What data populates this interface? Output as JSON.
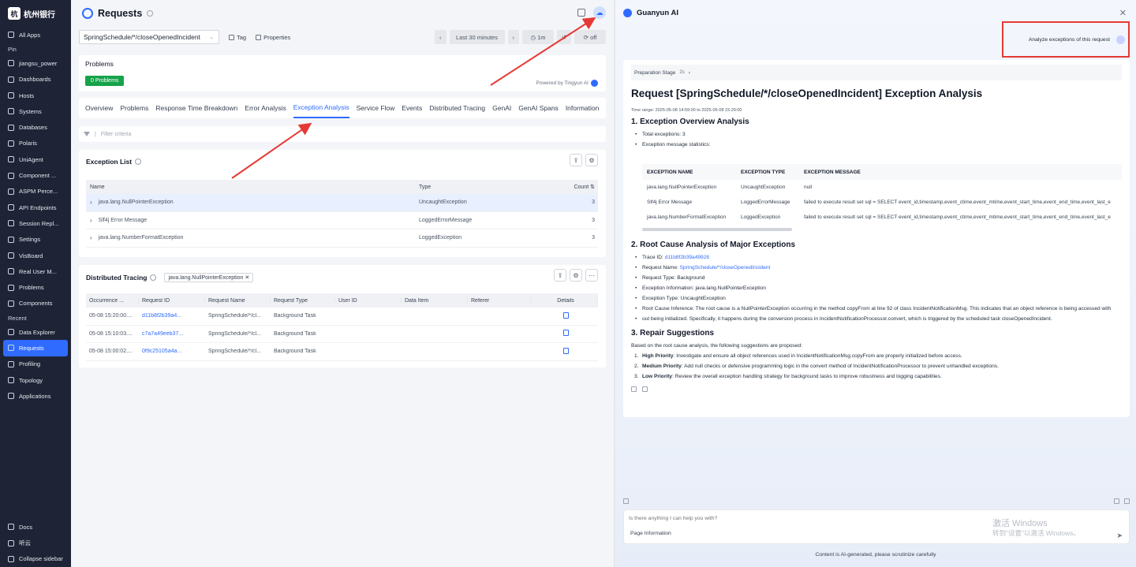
{
  "sidebar": {
    "logo_text": "杭州银行",
    "items_top": [
      "All Apps"
    ],
    "pin_label": "Pin",
    "pinned": [
      "jiangsu_power",
      "Dashboards",
      "Hosts",
      "Systems",
      "Databases",
      "Polaris",
      "UniAgent",
      "Component ...",
      "ASPM Perce...",
      "API Endpoints",
      "Session Repl...",
      "Settings",
      "VisBoard",
      "Real User M...",
      "Problems",
      "Components"
    ],
    "recent_label": "Recent",
    "recent": [
      "Data Explorer",
      "Requests",
      "Profiling",
      "Topology",
      "Applications"
    ],
    "bottom": [
      "Docs",
      "听云",
      "Collapse sidebar"
    ]
  },
  "header": {
    "title": "Requests"
  },
  "filters": {
    "request_select": "SpringSchedule/*/closeOpenedIncident",
    "tag": "Tag",
    "properties": "Properties",
    "time_range": "Last 30 minutes",
    "interval": "1m",
    "refresh": "off"
  },
  "problems": {
    "title": "Problems",
    "badge": "0 Problems",
    "powered": "Powered by Tingyun AI"
  },
  "tabs": [
    "Overview",
    "Problems",
    "Response Time Breakdown",
    "Error Analysis",
    "Exception Analysis",
    "Service Flow",
    "Events",
    "Distributed Tracing",
    "GenAI",
    "GenAI Spans",
    "Information"
  ],
  "criteria_placeholder": "Filter criteria",
  "exception_list": {
    "title": "Exception List",
    "headers": {
      "name": "Name",
      "type": "Type",
      "count": "Count"
    },
    "rows": [
      {
        "name": "java.lang.NullPointerException",
        "type": "UncaughtException",
        "count": "3"
      },
      {
        "name": "Slf4j Error Message",
        "type": "LoggedErrorMessage",
        "count": "3"
      },
      {
        "name": "java.lang.NumberFormatException",
        "type": "LoggedException",
        "count": "3"
      }
    ]
  },
  "distributed": {
    "title": "Distributed Tracing",
    "filter_tag": "java.lang.NullPointerException",
    "headers": [
      "Occurrence ...",
      "Request ID",
      "Request Name",
      "Request Type",
      "User ID",
      "Data Item",
      "Referer",
      "Details"
    ],
    "rows": [
      [
        "05-08 15:20:00....",
        "d11b8f2b39a4...",
        "SpringSchedule/*/cl...",
        "Background Task",
        "",
        "",
        ""
      ],
      [
        "05-08 15:10:03....",
        "c7a7a49eeb37...",
        "SpringSchedule/*/cl...",
        "Background Task",
        "",
        "",
        ""
      ],
      [
        "05-08 15:00:02....",
        "0f9c25105a4a...",
        "SpringSchedule/*/cl...",
        "Background Task",
        "",
        "",
        ""
      ]
    ]
  },
  "ai": {
    "title": "Guanyun AI",
    "user_message": "Analyze exceptions of this request",
    "prep_stage": "Preparation Stage",
    "prep_time": "2s",
    "report_title": "Request [SpringSchedule/*/closeOpenedIncident] Exception Analysis",
    "time_range": "Time range: 2025-05-08 14:59:00 to 2025-05-08 15:29:00",
    "s1_title": "1. Exception Overview Analysis",
    "s1_total": "Total exceptions: 3",
    "s1_stats": "Exception message statistics:",
    "ex_headers": [
      "EXCEPTION NAME",
      "EXCEPTION TYPE",
      "EXCEPTION MESSAGE"
    ],
    "ex_rows": [
      [
        "java.lang.NullPointerException",
        "UncaughtException",
        "null"
      ],
      [
        "Slf4j Error Message",
        "LoggedErrorMessage",
        "failed to execute result set sql = SELECT event_id,timestamp,event_ctime,event_mtime,event_start_time,event_end_time,event_last_e"
      ],
      [
        "java.lang.NumberFormatException",
        "LoggedException",
        "failed to execute result set sql = SELECT event_id,timestamp,event_ctime,event_mtime,event_start_time,event_end_time,event_last_e"
      ]
    ],
    "s2_title": "2. Root Cause Analysis of Major Exceptions",
    "trace_label": "Trace ID: ",
    "trace_id": "d11b8f2b39a49928",
    "req_name_label": "Request Name: ",
    "req_name": "SpringSchedule/*/closeOpenedIncident",
    "req_type": "Request Type: Background",
    "exc_info": "Exception Information: java.lang.NullPointerException",
    "exc_type": "Exception Type: UncaughtException",
    "rci_1": "Root Cause Inference: The root cause is a NullPointerException occurring in the method copyFrom at line 92 of class IncidentNotificationMsg. This indicates that an object reference is being accessed with",
    "rci_2": "out being initialized. Specifically, it happens during the conversion process in IncidentNotificationProcessor.convert, which is triggered by the scheduled task closeOpenedIncident.",
    "s3_title": "3. Repair Suggestions",
    "s3_intro": "Based on the root cause analysis, the following suggestions are proposed:",
    "sug": [
      {
        "n": "1.",
        "p": "High Priority",
        "t": ": Investigate and ensure all object references used in IncidentNotificationMsg.copyFrom are properly initialized before access."
      },
      {
        "n": "2.",
        "p": "Medium Priority",
        "t": ": Add null checks or defensive programming logic in the convert method of IncidentNotificationProcessor to prevent unhandled exceptions."
      },
      {
        "n": "3.",
        "p": "Low Priority",
        "t": ": Review the overall exception handling strategy for background tasks to improve robustness and logging capabilities."
      }
    ],
    "input_placeholder": "Is there anything I can help you with?",
    "page_info": "Page Information",
    "watermark_1": "激活 Windows",
    "watermark_2": "转到\"设置\"以激活 Windows。",
    "footer": "Content is AI-generated, please scrutinize carefully"
  },
  "colors": {
    "accent": "#2f6bff",
    "sidebar": "#1e2336",
    "highlight": "#e53935",
    "success": "#16a34a"
  }
}
